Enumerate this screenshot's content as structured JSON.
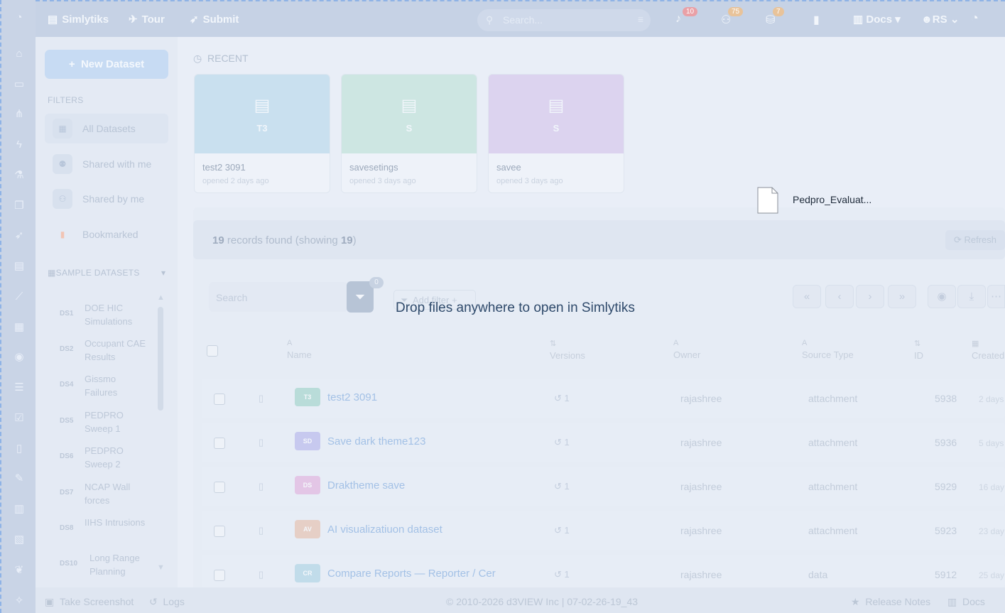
{
  "topnav": {
    "brand": "Simlytiks",
    "tour": "Tour",
    "submit": "Submit",
    "search_placeholder": "Search...",
    "notifications_count": "10",
    "shares_count": "75",
    "cart_count": "7",
    "docs": "Docs",
    "user": "RS"
  },
  "sidebar": {
    "new_dataset": "New Dataset",
    "filters_title": "FILTERS",
    "filters": [
      {
        "label": "All Datasets",
        "icon": "table-icon"
      },
      {
        "label": "Shared with me",
        "icon": "users-icon"
      },
      {
        "label": "Shared by me",
        "icon": "share-icon"
      },
      {
        "label": "Bookmarked",
        "icon": "bookmark-icon"
      }
    ],
    "sample_title": "SAMPLE DATASETS",
    "samples": [
      {
        "code": "DS1",
        "name": "DOE HIC Simulations"
      },
      {
        "code": "DS2",
        "name": "Occupant CAE Results"
      },
      {
        "code": "DS4",
        "name": "Gissmo Failures"
      },
      {
        "code": "DS5",
        "name": "PEDPRO Sweep 1"
      },
      {
        "code": "DS6",
        "name": "PEDPRO Sweep 2"
      },
      {
        "code": "DS7",
        "name": "NCAP Wall forces"
      },
      {
        "code": "DS8",
        "name": "IIHS Intrusions"
      },
      {
        "code": "DS10",
        "name": "Long Range Planning"
      }
    ]
  },
  "recent": {
    "title": "RECENT",
    "cards": [
      {
        "abbr": "T3",
        "name": "test2 3091",
        "sub": "opened 2 days ago",
        "color": "#c9e0ef"
      },
      {
        "abbr": "S",
        "name": "savesetings",
        "sub": "opened 3 days ago",
        "color": "#cde6e2"
      },
      {
        "abbr": "S",
        "name": "savee",
        "sub": "opened 3 days ago",
        "color": "#dcd3ef"
      }
    ]
  },
  "records": {
    "count": "19",
    "mid": " records found (showing ",
    "showing": "19",
    "end": ")",
    "refresh": "Refresh"
  },
  "toolbar": {
    "search_placeholder": "Search",
    "filter_count": "0",
    "add_filter": "Add filter"
  },
  "drop_message": "Drop files anywhere to open in Simlytiks",
  "dragged_file": "Pedpro_Evaluat...",
  "columns": {
    "name": "Name",
    "versions": "Versions",
    "owner": "Owner",
    "source": "Source Type",
    "id": "ID",
    "created": "Created"
  },
  "rows": [
    {
      "abbr": "T3",
      "color": "#b9dcd9",
      "name": "test2 3091",
      "versions": "1",
      "owner": "rajashree",
      "source": "attachment",
      "id": "5938",
      "created": "2 days"
    },
    {
      "abbr": "SD",
      "color": "#c7c9ef",
      "name": "Save dark theme123",
      "versions": "1",
      "owner": "rajashree",
      "source": "attachment",
      "id": "5936",
      "created": "5 days"
    },
    {
      "abbr": "DS",
      "color": "#e3c6e6",
      "name": "Draktheme save",
      "versions": "1",
      "owner": "rajashree",
      "source": "attachment",
      "id": "5929",
      "created": "16 day"
    },
    {
      "abbr": "AV",
      "color": "#e6cfc6",
      "name": "AI visualizatiuon dataset",
      "versions": "1",
      "owner": "rajashree",
      "source": "attachment",
      "id": "5923",
      "created": "23 day"
    },
    {
      "abbr": "CR",
      "color": "#c1dcea",
      "name": "Compare Reports — Reporter / Cer",
      "versions": "1",
      "owner": "rajashree",
      "source": "data",
      "id": "5912",
      "created": "25 day"
    }
  ],
  "footer": {
    "screenshot": "Take Screenshot",
    "logs": "Logs",
    "copyright": "© 2010-2026 d3VIEW Inc | 07-02-26-19_43",
    "release_notes": "Release Notes",
    "docs": "Docs"
  }
}
